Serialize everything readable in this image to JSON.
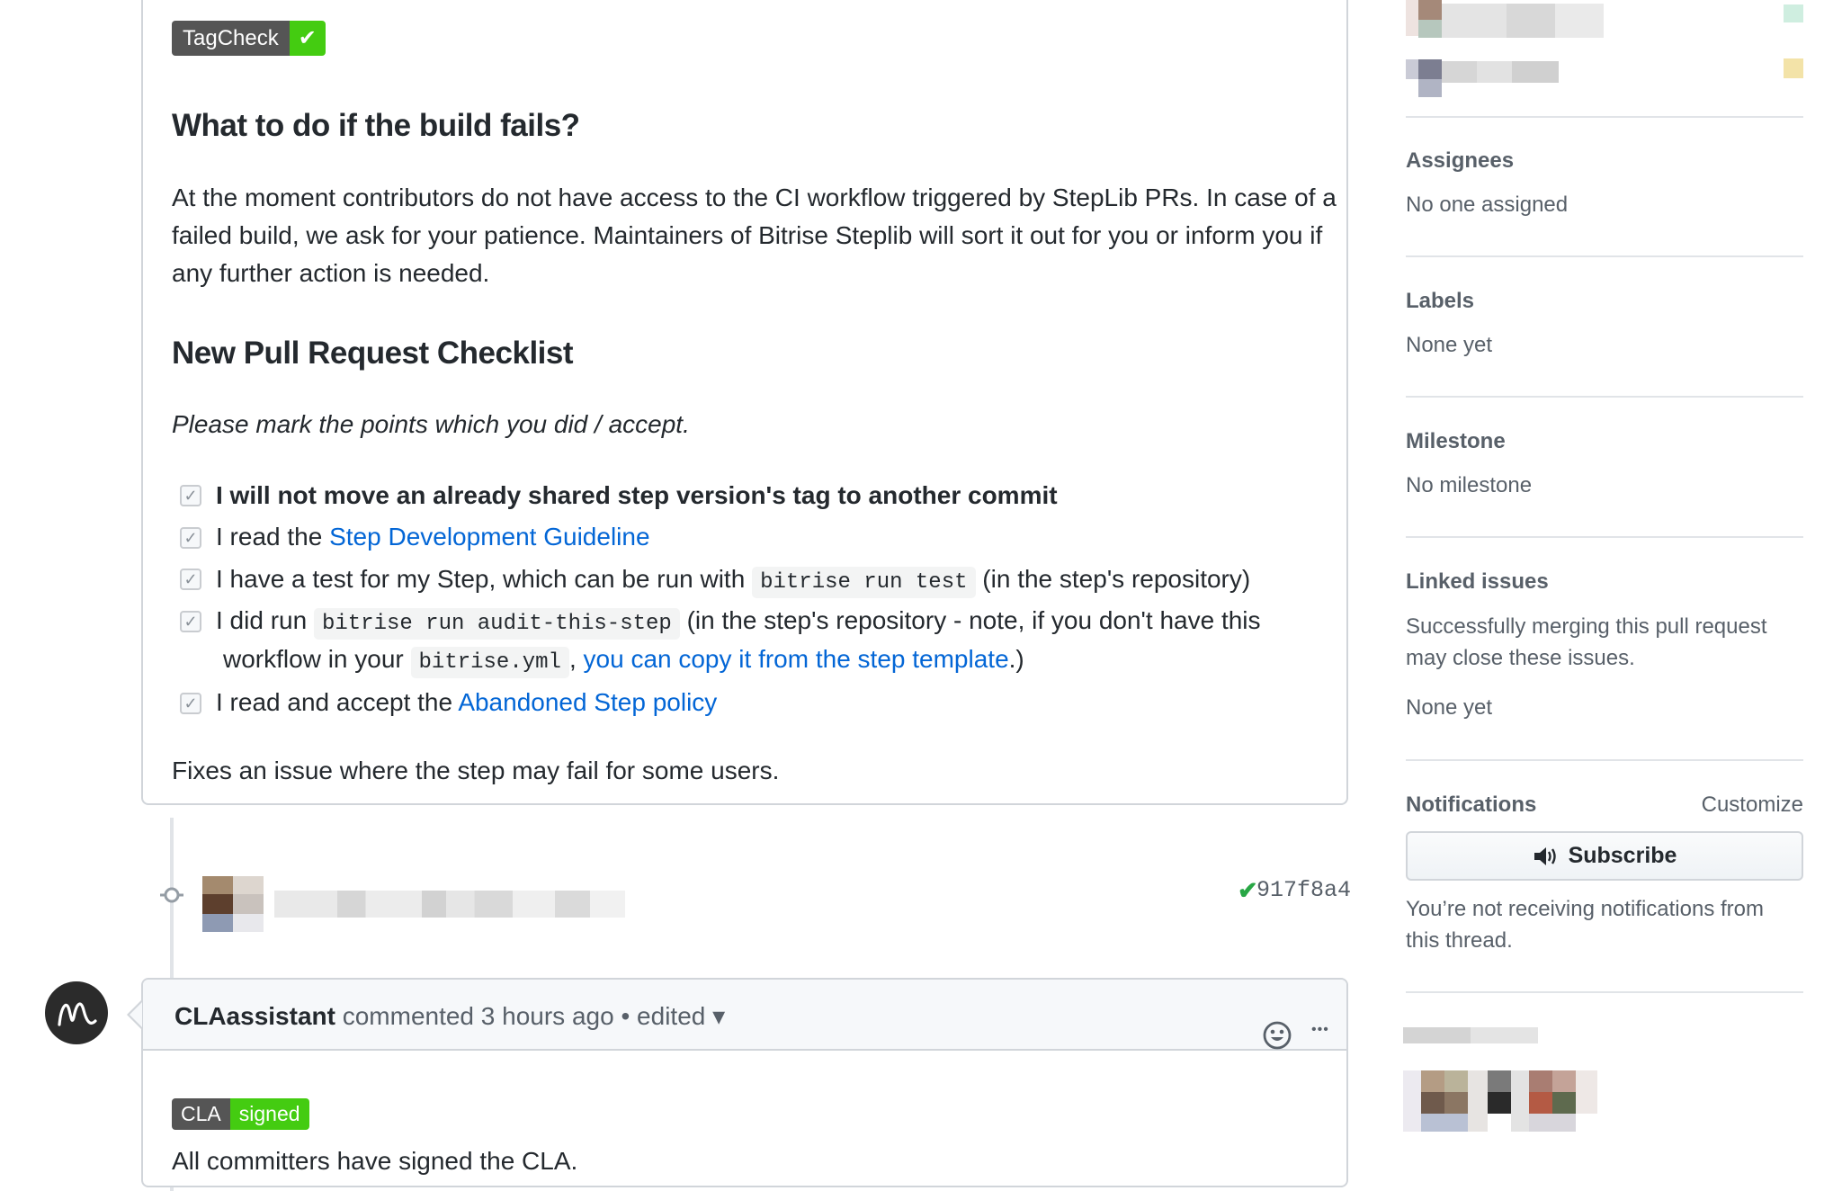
{
  "tagcheck_badge": {
    "left": "TagCheck",
    "right": "✔"
  },
  "build_fails": {
    "heading": "What to do if the build fails?",
    "body": "At the moment contributors do not have access to the CI workflow triggered by StepLib PRs. In case of a failed build, we ask for your patience. Maintainers of Bitrise Steplib will sort it out for you or inform you if any further action is needed."
  },
  "checklist": {
    "heading": "New Pull Request Checklist",
    "intro": "Please mark the points which you did / accept.",
    "item1": "I will not move an already shared step version's tag to another commit",
    "item2_pre": "I read the ",
    "item2_link": "Step Development Guideline",
    "item3_pre": "I have a test for my Step, which can be run with ",
    "item3_code": "bitrise run test",
    "item3_post": " (in the step's repository)",
    "item4_pre": "I did run ",
    "item4_code": "bitrise run audit-this-step",
    "item4_post": " (in the step's repository - note, if you don't have this",
    "item4_line2_pre": "workflow in your ",
    "item4_code2": "bitrise.yml",
    "item4_line2_mid": ", ",
    "item4_link": "you can copy it from the step template",
    "item4_line2_post": ".)",
    "item5_pre": "I read and accept the ",
    "item5_link": "Abandoned Step policy",
    "check_glyph": "✓"
  },
  "fixes_text": "Fixes an issue where the step may fail for some users.",
  "commit": {
    "sha": "917f8a4",
    "status_icon": "check-icon",
    "status_glyph": "✔"
  },
  "cla_comment": {
    "author": "CLAassistant",
    "meta": " commented 3 hours ago",
    "edited": " • edited",
    "caret": "▾",
    "badge_left": "CLA",
    "badge_right": "signed",
    "body": "All committers have signed the CLA.",
    "more_glyph": "•••"
  },
  "sidebar": {
    "assignees": {
      "heading": "Assignees",
      "value": "No one assigned"
    },
    "labels": {
      "heading": "Labels",
      "value": "None yet"
    },
    "milestone": {
      "heading": "Milestone",
      "value": "No milestone"
    },
    "linked": {
      "heading": "Linked issues",
      "desc": "Successfully merging this pull request may close these issues.",
      "value": "None yet"
    },
    "notifications": {
      "heading": "Notifications",
      "customize": "Customize",
      "button": "Subscribe",
      "note": "You’re not receiving notifications from this thread."
    }
  },
  "colors": {
    "link": "#0366d6",
    "badge_green": "#44cc11",
    "badge_gray": "#555555",
    "success": "#28a745"
  }
}
